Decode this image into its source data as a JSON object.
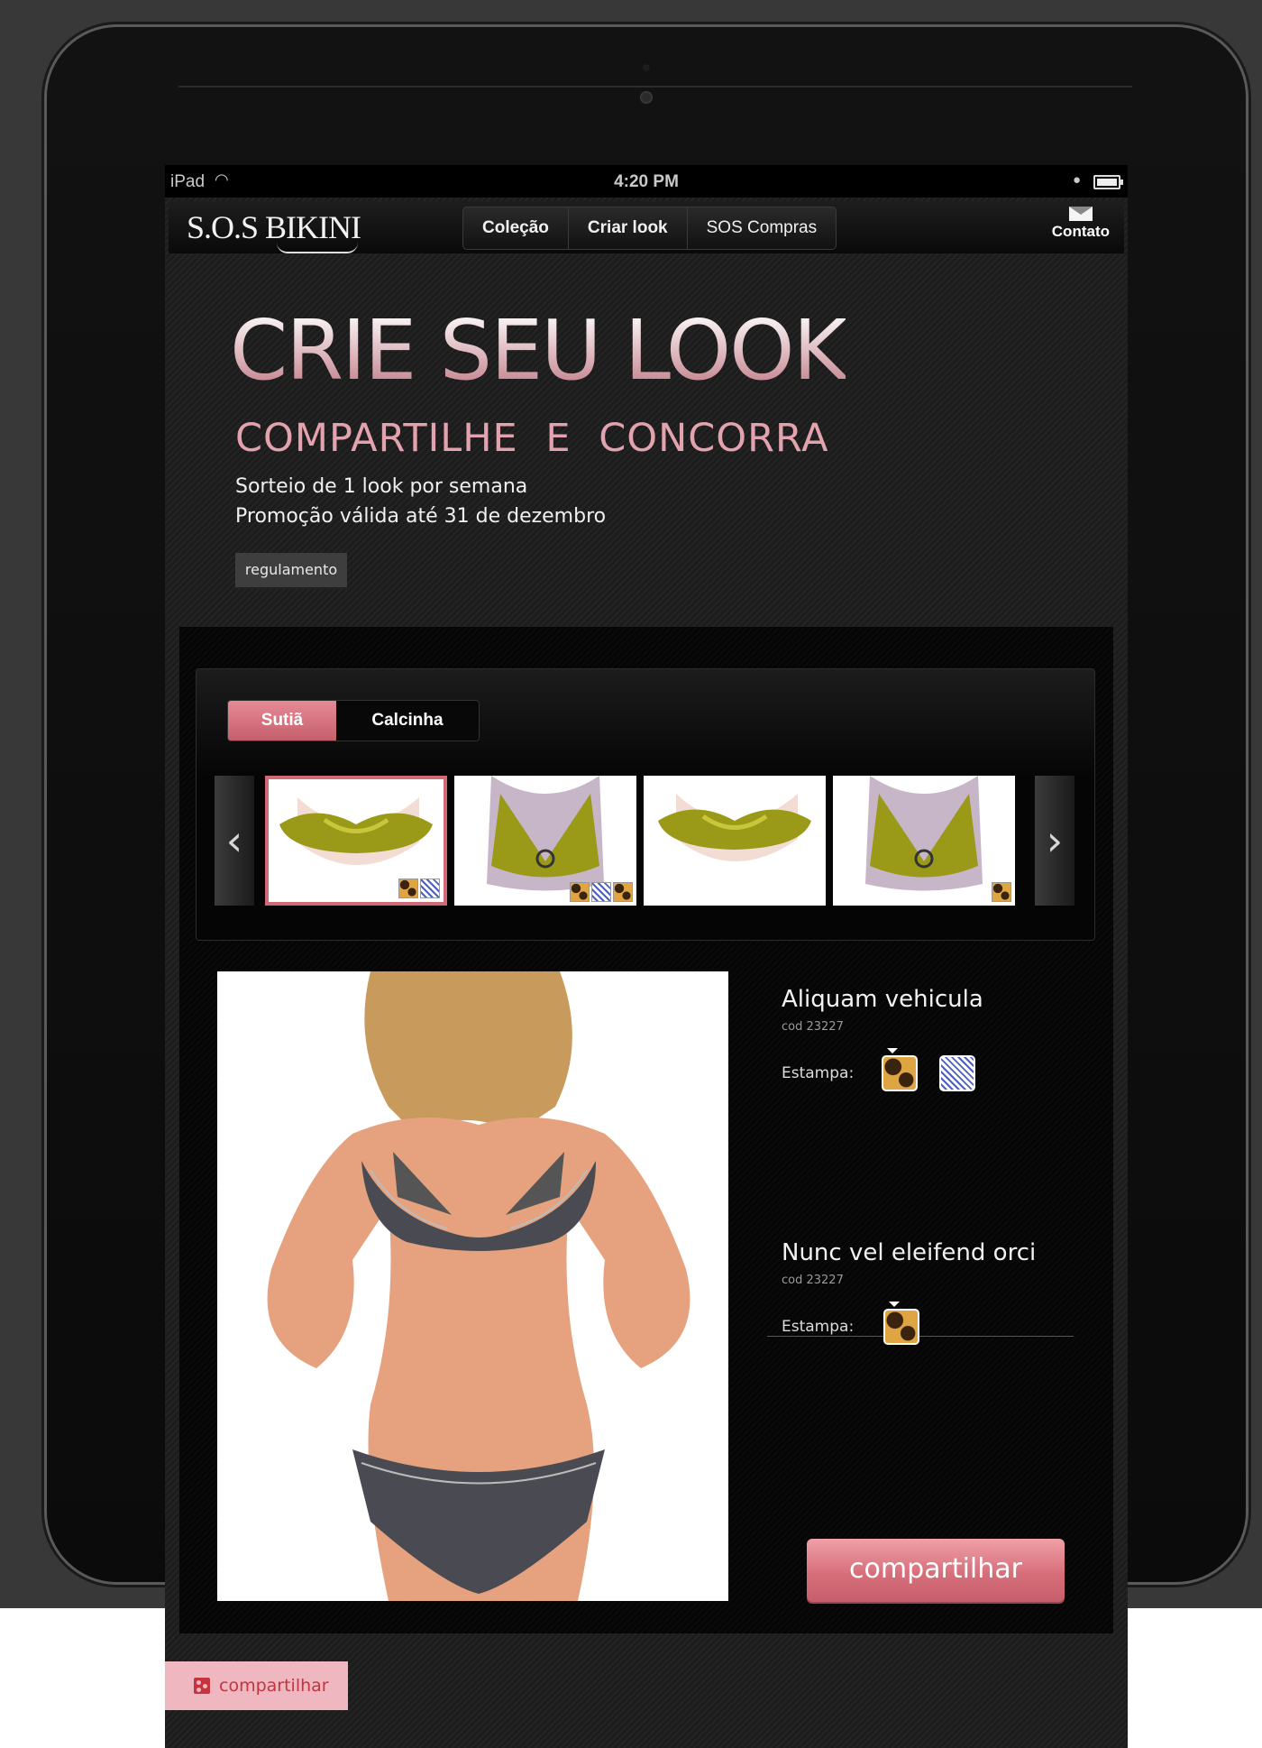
{
  "status_bar": {
    "carrier": "iPad",
    "time": "4:20 PM"
  },
  "header": {
    "logo": "S.O.S BIKINI",
    "nav": [
      "Coleção",
      "Criar look",
      "SOS Compras"
    ],
    "contact": "Contato"
  },
  "hero": {
    "title": "CRIE SEU LOOK",
    "subtitle": "COMPARTILHE E CONCORRA",
    "line1": "Sorteio de 1 look por semana",
    "line2": "Promoção válida até 31 de dezembro",
    "rules_button": "regulamento"
  },
  "tabs": {
    "active": "Sutiã",
    "inactive": "Calcinha"
  },
  "products": [
    {
      "name": "Aliquam vehicula",
      "code": "cod 23227",
      "print_label": "Estampa:"
    },
    {
      "name": "Nunc vel eleifend orci",
      "code": "cod 23227",
      "print_label": "Estampa:"
    }
  ],
  "share_button": "compartilhar",
  "bottom_share": "compartilhar",
  "colors": {
    "accent": "#d76f7b",
    "background": "#1c1c1c",
    "bra_gold": "#9a9a18"
  }
}
